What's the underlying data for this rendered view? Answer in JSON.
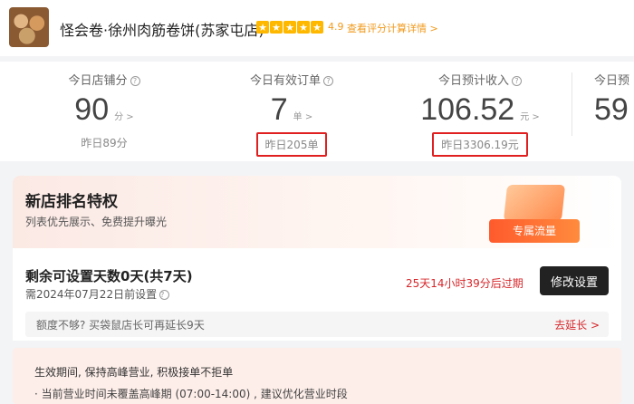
{
  "header": {
    "shop_name": "怪会卷·徐州肉筋卷饼(苏家屯店)",
    "rating": "4.9",
    "rating_link": "查看评分计算详情 >",
    "stars": [
      "★",
      "★",
      "★",
      "★",
      "★"
    ]
  },
  "stats": [
    {
      "label": "今日店铺分",
      "value": "90",
      "unit": "分 >",
      "sub": "昨日89分"
    },
    {
      "label": "今日有效订单",
      "value": "7",
      "unit": "单 >",
      "sub": "昨日205单"
    },
    {
      "label": "今日预计收入",
      "value": "106.52",
      "unit": "元 >",
      "sub": "昨日3306.19元"
    },
    {
      "label": "今日预",
      "value": "59"
    }
  ],
  "privilege": {
    "title": "新店排名特权",
    "subtitle": "列表优先展示、免费提升曝光",
    "badge": "专属流量"
  },
  "remaining": {
    "title": "剩余可设置天数0天(共7天)",
    "deadline": "需2024年07月22日前设置",
    "countdown": "25天14小时39分后过期",
    "button": "修改设置"
  },
  "extend": {
    "text": "额度不够? 买袋鼠店长可再延长9天",
    "link": "去延长 >"
  },
  "notice": {
    "line1": "生效期间, 保持高峰营业, 积极接单不拒单",
    "line2": "· 当前营业时间未覆盖高峰期 (07:00-14:00) , 建议优化营业时段"
  },
  "colors": {
    "accent": "#d6262a",
    "star": "#ffb800",
    "highlight_box": "#e02020"
  }
}
